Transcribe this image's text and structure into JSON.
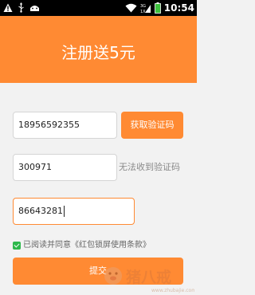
{
  "status_bar": {
    "time": "10:54",
    "icons": [
      "warning-icon",
      "usb-icon",
      "android-debug-icon",
      "wifi-icon",
      "signal-icon",
      "battery-icon"
    ]
  },
  "header": {
    "title": "注册送5元"
  },
  "form": {
    "phone_value": "18956592355",
    "get_code_label": "获取验证码",
    "code_value": "300971",
    "no_code_label": "无法收到验证码",
    "third_value": "86643281"
  },
  "agreement": {
    "checked": true,
    "text": "已阅读并同意《红包锁屏使用条款》"
  },
  "submit_label": "提交",
  "watermark": {
    "text": "猪八戒",
    "url": "www.zhubajie.com"
  },
  "colors": {
    "accent": "#ff8a33",
    "background": "#f2f2f2",
    "checkbox": "#2db84b"
  }
}
